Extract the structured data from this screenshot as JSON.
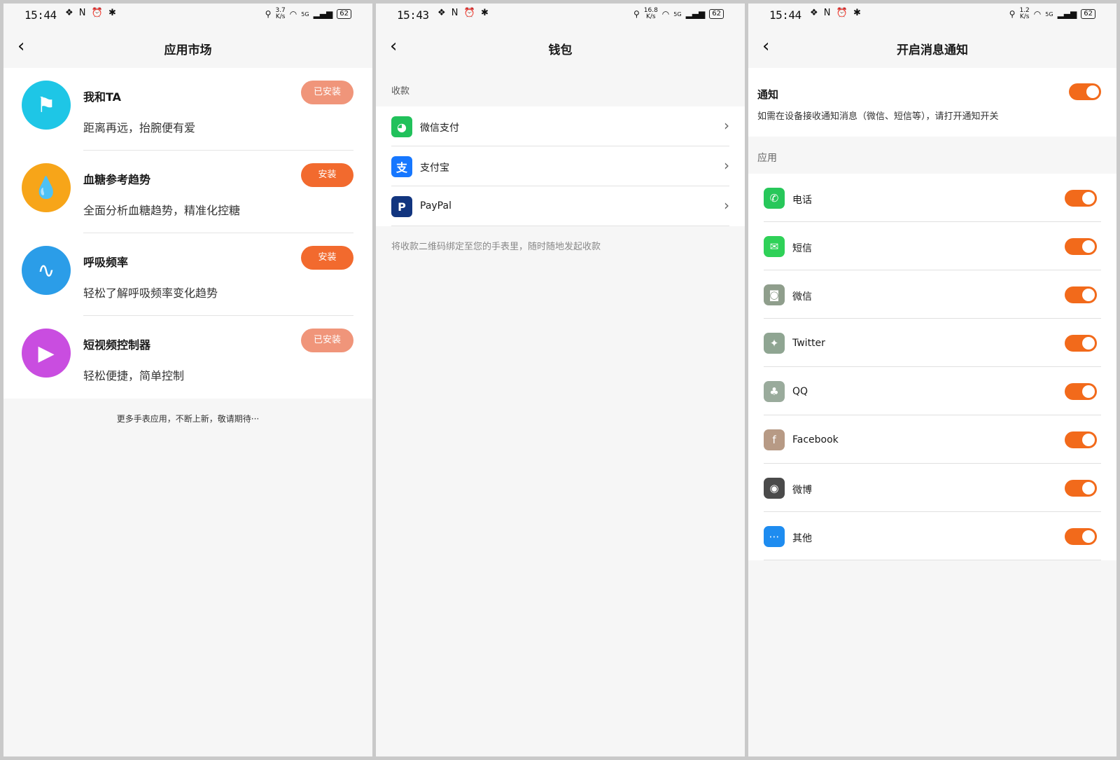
{
  "screens": [
    {
      "status": {
        "time": "15:44",
        "speed_val": "3.7",
        "speed_unit": "K/s",
        "net": "5G",
        "battery": "62"
      },
      "title": "应用市场",
      "apps": [
        {
          "name": "我和TA",
          "desc": "距离再远，抬腕便有爱",
          "button": "已安装",
          "state": "installed",
          "color": "#1ec6e6",
          "icon": "flag-map-icon"
        },
        {
          "name": "血糖参考趋势",
          "desc": "全面分析血糖趋势，精准化控糖",
          "button": "安装",
          "state": "install",
          "color": "#f7a519",
          "icon": "blood-drop-icon"
        },
        {
          "name": "呼吸频率",
          "desc": "轻松了解呼吸频率变化趋势",
          "button": "安装",
          "state": "install",
          "color": "#2b9de8",
          "icon": "breath-wave-icon"
        },
        {
          "name": "短视频控制器",
          "desc": "轻松便捷，简单控制",
          "button": "已安装",
          "state": "installed",
          "color": "#c94de0",
          "icon": "play-icon"
        }
      ],
      "footer": "更多手表应用，不断上新，敬请期待···"
    },
    {
      "status": {
        "time": "15:43",
        "speed_val": "16.8",
        "speed_unit": "K/s",
        "net": "5G",
        "battery": "62"
      },
      "title": "钱包",
      "section": "收款",
      "payments": [
        {
          "label": "微信支付",
          "color": "#21c15b",
          "glyph": "◕",
          "icon": "wechat-pay-icon"
        },
        {
          "label": "支付宝",
          "color": "#1677ff",
          "glyph": "支",
          "icon": "alipay-icon"
        },
        {
          "label": "PayPal",
          "color": "#12357f",
          "glyph": "P",
          "icon": "paypal-icon"
        }
      ],
      "note": "将收款二维码绑定至您的手表里，随时随地发起收款"
    },
    {
      "status": {
        "time": "15:44",
        "speed_val": "1.2",
        "speed_unit": "K/s",
        "net": "5G",
        "battery": "62"
      },
      "title": "开启消息通知",
      "notify": {
        "title": "通知",
        "desc": "如需在设备接收通知消息（微信、短信等），请打开通知开关",
        "on": true
      },
      "section": "应用",
      "apps": [
        {
          "label": "电话",
          "color": "#27c75a",
          "glyph": "✆",
          "icon": "phone-icon",
          "on": true
        },
        {
          "label": "短信",
          "color": "#2fd158",
          "glyph": "✉",
          "icon": "sms-icon",
          "on": true
        },
        {
          "label": "微信",
          "color": "#8f9e8c",
          "glyph": "◙",
          "icon": "wechat-icon",
          "on": true
        },
        {
          "label": "Twitter",
          "color": "#8fa592",
          "glyph": "✦",
          "icon": "twitter-icon",
          "on": true
        },
        {
          "label": "QQ",
          "color": "#9aab9c",
          "glyph": "♣",
          "icon": "qq-icon",
          "on": true
        },
        {
          "label": "Facebook",
          "color": "#b79a85",
          "glyph": "f",
          "icon": "facebook-icon",
          "on": true
        },
        {
          "label": "微博",
          "color": "#4a4a4a",
          "glyph": "◉",
          "icon": "weibo-icon",
          "on": true
        },
        {
          "label": "其他",
          "color": "#1e8cf0",
          "glyph": "⋯",
          "icon": "more-icon",
          "on": true
        }
      ]
    }
  ]
}
